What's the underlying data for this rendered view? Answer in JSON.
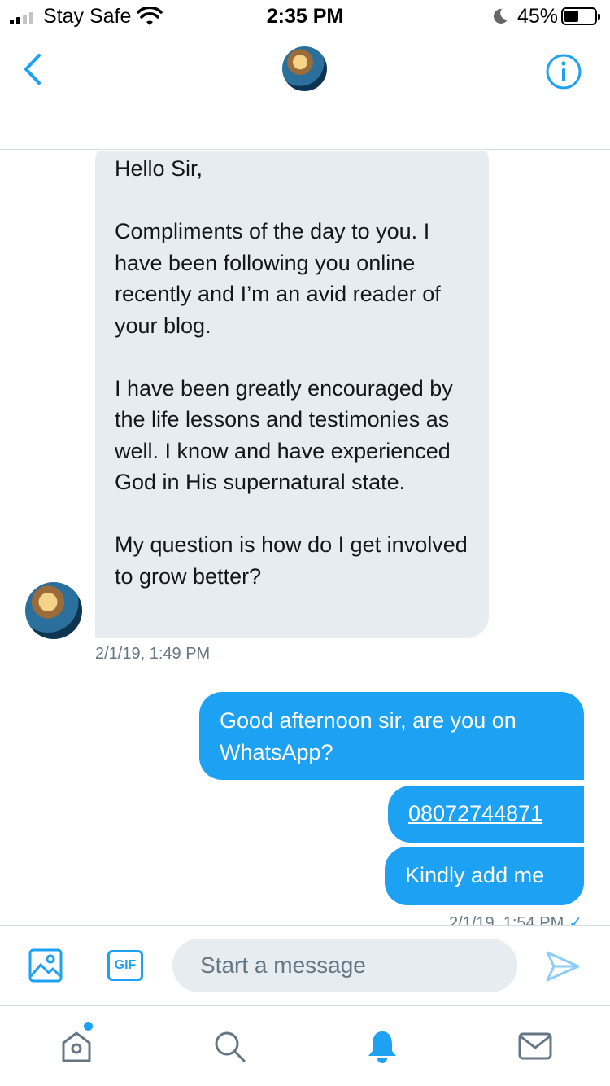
{
  "status_bar": {
    "carrier": "Stay Safe",
    "time": "2:35 PM",
    "battery": "45%",
    "signal_bars": 2,
    "signal_total": 4,
    "battery_level": 0.45
  },
  "header": {
    "back_icon": "chevron-left-icon",
    "info_icon": "info-icon",
    "accent_color": "#1da1f2"
  },
  "conversation": {
    "received": {
      "paragraphs": [
        "Hello Sir,",
        "Compliments of the day to you. I have been following you online recently and I’m an avid reader of your blog.",
        "I have been greatly encouraged by the life lessons and testimonies as well. I know and have experienced God in His supernatural state.",
        "My question is how do I get involved to grow better?"
      ],
      "timestamp": "2/1/19, 1:49 PM",
      "bubble_color": "#e6ecf0"
    },
    "sent": {
      "messages": [
        "Good afternoon sir, are you on WhatsApp?",
        "08072744871",
        "Kindly add me"
      ],
      "timestamp": "2/1/19, 1:54 PM",
      "read_mark": "✓",
      "bubble_color": "#1da1f2"
    }
  },
  "composer": {
    "placeholder": "Start a message",
    "gif_label": "GIF",
    "photo_icon": "image-icon",
    "send_icon": "send-icon"
  },
  "tab_bar": {
    "items": [
      "home-icon",
      "search-icon",
      "notifications-icon",
      "messages-icon"
    ],
    "active": "notifications"
  }
}
